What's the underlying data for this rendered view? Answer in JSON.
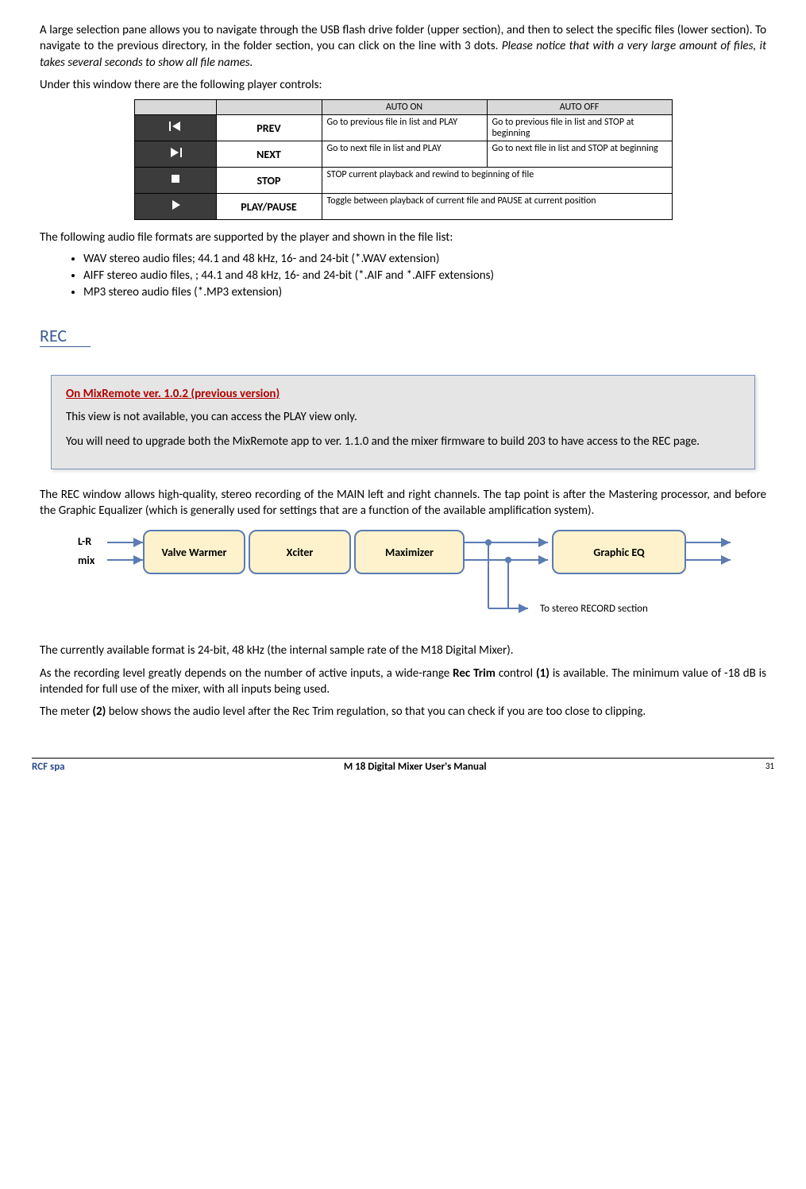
{
  "para1_a": "A large selection pane allows you to navigate through the USB flash drive folder (upper section), and then to select the specific files (lower section).  To navigate to the previous directory, in the folder section, you can click on the line with 3 dots. ",
  "para1_b": "Please notice that with a very large amount of files, it takes several seconds to show all file names.",
  "para2": "Under this window there are the following player controls:",
  "table": {
    "hdr_auto_on": "AUTO ON",
    "hdr_auto_off": "AUTO OFF",
    "rows": [
      {
        "label": "PREV",
        "on": "Go to previous file in list and PLAY",
        "off": "Go to previous file in list and STOP at beginning"
      },
      {
        "label": "NEXT",
        "on": "Go to next file in list and PLAY",
        "off": "Go to next file in list and STOP at beginning"
      },
      {
        "label": "STOP",
        "span": "STOP current playback and rewind to beginning of file"
      },
      {
        "label": "PLAY/PAUSE",
        "span": "Toggle between playback of current file and PAUSE at current position"
      }
    ]
  },
  "formats_intro": "The following audio file formats are supported by the player and shown in the file list:",
  "formats": [
    "WAV stereo audio files; 44.1 and 48 kHz, 16- and 24-bit   (*.WAV extension)",
    "AIFF stereo audio files, ; 44.1 and 48 kHz, 16- and 24-bit   (*.AIF and *.AIFF extensions)",
    "MP3 stereo audio files   (*.MP3 extension)"
  ],
  "rec_heading": "REC",
  "notice": {
    "title": "On MixRemote ver. 1.0.2 (previous version)",
    "p1": "This view is not available, you can access the PLAY view only.",
    "p2": "You will need to upgrade both the MixRemote app to ver. 1.1.0 and the mixer firmware to build 203 to have access to the REC page."
  },
  "rec_para1": "The REC window allows high-quality, stereo recording of the MAIN left and right channels. The tap point is after the Mastering processor, and before the Graphic Equalizer (which is generally used for settings that are a function of the available amplification system).",
  "flow": {
    "in1": "L-R",
    "in2": "mix",
    "b1": "Valve Warmer",
    "b2": "Xciter",
    "b3": "Maximizer",
    "b4": "Graphic EQ",
    "caption": "To stereo RECORD section"
  },
  "rec_para2": "The currently available format is 24-bit, 48 kHz (the internal sample rate of the M18 Digital Mixer).",
  "rec_para3_a": "As the recording level greatly depends on the number of active inputs, a wide-range ",
  "rec_para3_b": "Rec Trim",
  "rec_para3_c": " control ",
  "rec_para3_d": "(1)",
  "rec_para3_e": " is available. The minimum value of -18 dB is intended for full use of the mixer, with all inputs being used.",
  "rec_para4_a": "The meter ",
  "rec_para4_b": "(2)",
  "rec_para4_c": " below shows the audio level after the Rec Trim regulation, so that you can check if you are too close to clipping.",
  "footer": {
    "left": "RCF spa",
    "center": "M 18 Digital Mixer User's Manual",
    "right": "31"
  }
}
